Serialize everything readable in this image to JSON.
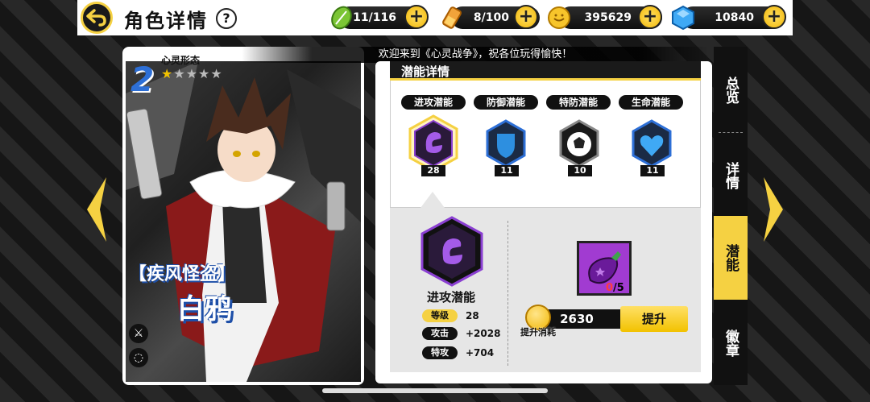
{
  "header": {
    "title": "角色详情",
    "help": "?",
    "stamina": "11/116",
    "energy": "8/100",
    "gold": "395629",
    "diamonds": "10840",
    "plus": "+"
  },
  "marquee": "欢迎来到《心灵战争》，祝各位玩得愉快！",
  "character": {
    "star_number": "2",
    "form_label": "心灵形态",
    "stars_filled": 1,
    "stars_total": 5,
    "title_tag": "【疾风怪盗】",
    "name": "白鸦"
  },
  "panel": {
    "header": "潜能详情",
    "tabs": [
      {
        "label": "进攻潜能",
        "level": "28",
        "color": "#8a3fd1"
      },
      {
        "label": "防御潜能",
        "level": "11",
        "color": "#2d6fd6"
      },
      {
        "label": "特防潜能",
        "level": "10",
        "color": "#ffffff"
      },
      {
        "label": "生命潜能",
        "level": "11",
        "color": "#2d8fe0"
      }
    ],
    "detail": {
      "title": "进攻潜能",
      "stats": [
        {
          "label": "等级",
          "value": "28"
        },
        {
          "label": "攻击",
          "value": "+2028"
        },
        {
          "label": "特攻",
          "value": "+704"
        }
      ],
      "item_have": "0",
      "item_need": "/5",
      "cost": "2630",
      "cost_label": "提升消耗",
      "upgrade": "提升"
    }
  },
  "right_nav": [
    "总览",
    "详情",
    "潜能",
    "徽章"
  ]
}
